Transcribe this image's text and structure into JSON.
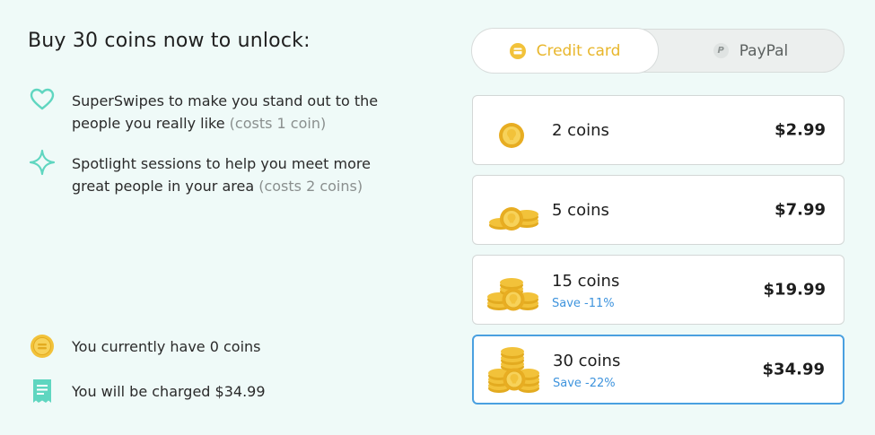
{
  "title": "Buy 30 coins now to unlock:",
  "features": [
    {
      "icon": "heart-outline-icon",
      "text": "SuperSwipes to make you stand out to the people you really like",
      "note": "(costs 1 coin)"
    },
    {
      "icon": "sparkle-icon",
      "text": "Spotlight sessions to help you meet more great people in your area",
      "note": "(costs 2 coins)"
    }
  ],
  "info": [
    {
      "icon": "coin-icon",
      "text": "You currently have 0 coins"
    },
    {
      "icon": "receipt-icon",
      "text": "You will be charged $34.99"
    }
  ],
  "payment": {
    "credit_label": "Credit card",
    "paypal_label": "PayPal",
    "selected": "Credit card"
  },
  "packs": [
    {
      "name": "2 coins",
      "price": "$2.99",
      "save": ""
    },
    {
      "name": "5 coins",
      "price": "$7.99",
      "save": ""
    },
    {
      "name": "15 coins",
      "price": "$19.99",
      "save": "Save -11%"
    },
    {
      "name": "30 coins",
      "price": "$34.99",
      "save": "Save -22%"
    }
  ],
  "selected_pack": "30 coins",
  "colors": {
    "background": "#effaf8",
    "accent_teal": "#5fd6c0",
    "gold": "#f2c23a",
    "selected_border": "#4aa0e0",
    "save_blue": "#3f94dd"
  }
}
